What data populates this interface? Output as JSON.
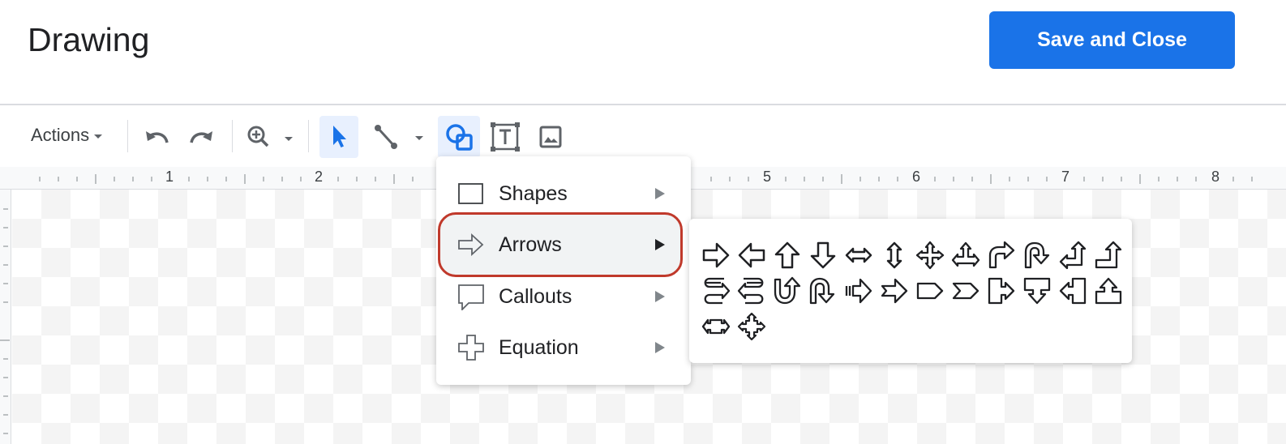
{
  "header": {
    "title": "Drawing",
    "save_label": "Save and Close"
  },
  "toolbar": {
    "actions_label": "Actions",
    "icons": [
      "undo-icon",
      "redo-icon",
      "zoom-icon",
      "select-icon",
      "line-icon",
      "shape-icon",
      "text-box-icon",
      "image-icon"
    ],
    "accent_color": "#1a73e8"
  },
  "ruler": {
    "numbers": [
      "1",
      "2",
      "5",
      "6",
      "7",
      "8"
    ]
  },
  "menu": {
    "items": [
      {
        "label": "Shapes",
        "icon": "rectangle-icon"
      },
      {
        "label": "Arrows",
        "icon": "arrow-right-icon"
      },
      {
        "label": "Callouts",
        "icon": "callout-icon"
      },
      {
        "label": "Equation",
        "icon": "plus-icon"
      }
    ],
    "highlighted": "Arrows",
    "highlight_color": "#c0392b"
  },
  "arrows_submenu": {
    "shapes": [
      "right-arrow",
      "left-arrow",
      "up-arrow",
      "down-arrow",
      "left-right-arrow",
      "up-down-arrow",
      "quad-arrow",
      "left-right-up-arrow",
      "bent-arrow",
      "u-turn-arrow",
      "left-up-arrow",
      "bent-up-arrow",
      "curved-right-arrow",
      "curved-left-arrow",
      "curved-up-arrow",
      "curved-down-arrow",
      "striped-right-arrow",
      "notched-right-arrow",
      "pentagon",
      "chevron",
      "right-arrow-callout",
      "down-arrow-callout",
      "left-arrow-callout",
      "up-arrow-callout",
      "left-right-arrow-callout",
      "quad-arrow-callout"
    ]
  }
}
